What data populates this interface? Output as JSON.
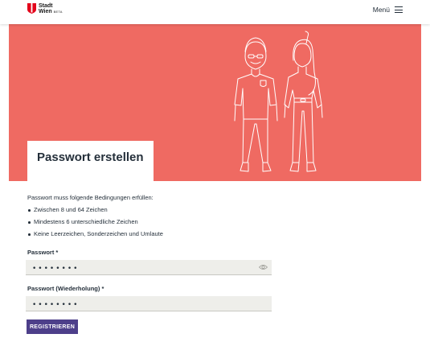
{
  "header": {
    "logo_line1": "Stadt",
    "logo_line2": "Wien",
    "logo_badge": "BETA",
    "menu_label": "Menü"
  },
  "hero": {
    "title": "Passwort erstellen",
    "background_color": "#ef6a62"
  },
  "requirements": {
    "intro": "Passwort muss folgende Bedingungen erfüllen:",
    "items": [
      {
        "label": "Zwischen 8 und 64 Zeichen"
      },
      {
        "label": "Mindestens 6 unterschiedliche Zeichen"
      },
      {
        "label": "Keine Leerzeichen, Sonderzeichen und Umlaute"
      }
    ]
  },
  "form": {
    "password_label": "Passwort *",
    "password_value": "••••••••",
    "password_repeat_label": "Passwort (Wiederholung) *",
    "password_repeat_value": "••••••••",
    "submit_label": "REGISTRIEREN",
    "submit_color": "#4d3f8a"
  }
}
